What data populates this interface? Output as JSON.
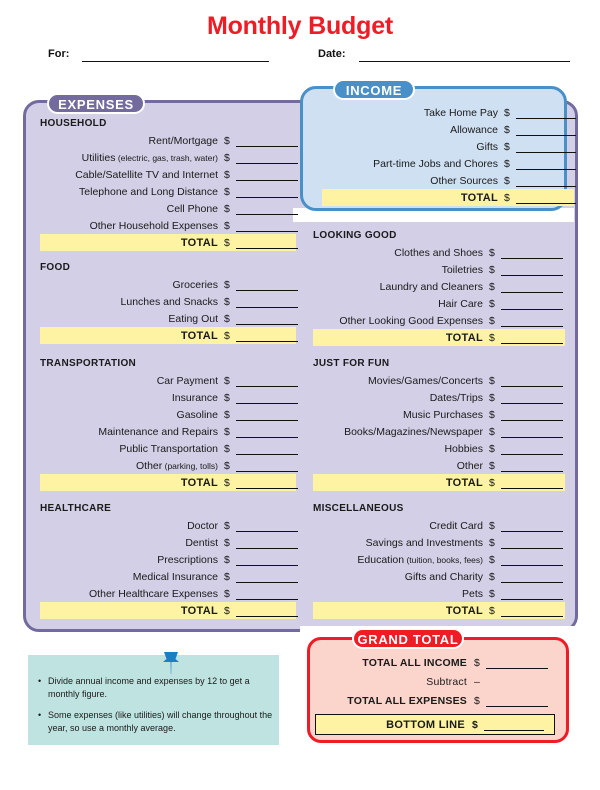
{
  "document": {
    "title": "Monthly Budget",
    "title_color": "#ee1c25"
  },
  "meta": {
    "for_label": "For:",
    "date_label": "Date:"
  },
  "currency_symbol": "$",
  "total_label": "TOTAL",
  "panels": {
    "expenses": {
      "tab_label": "EXPENSES",
      "fill": "#d3cfe6",
      "border": "#736a9e"
    },
    "income": {
      "tab_label": "INCOME",
      "fill": "#cfe0f2",
      "border": "#4a90c8"
    },
    "grand": {
      "tab_label": "GRAND TOTAL",
      "fill": "#fbd5cc",
      "border": "#ee1c25"
    }
  },
  "income": {
    "heading": "INCOME",
    "rows": [
      "Take Home Pay",
      "Allowance",
      "Gifts",
      "Part-time Jobs and Chores",
      "Other Sources"
    ],
    "total_label": "TOTAL"
  },
  "expenses": {
    "heading": "EXPENSES",
    "left_sections": [
      {
        "title": "HOUSEHOLD",
        "rows": [
          {
            "label": "Rent/Mortgage",
            "note": ""
          },
          {
            "label": "Utilities",
            "note": " (electric, gas, trash, water)"
          },
          {
            "label": "Cable/Satellite TV and Internet",
            "note": ""
          },
          {
            "label": "Telephone and Long Distance",
            "note": ""
          },
          {
            "label": "Cell Phone",
            "note": ""
          },
          {
            "label": "Other Household Expenses",
            "note": ""
          }
        ]
      },
      {
        "title": "FOOD",
        "rows": [
          {
            "label": "Groceries",
            "note": ""
          },
          {
            "label": "Lunches and Snacks",
            "note": ""
          },
          {
            "label": "Eating Out",
            "note": ""
          }
        ]
      },
      {
        "title": "TRANSPORTATION",
        "rows": [
          {
            "label": "Car Payment",
            "note": ""
          },
          {
            "label": "Insurance",
            "note": ""
          },
          {
            "label": "Gasoline",
            "note": ""
          },
          {
            "label": "Maintenance and Repairs",
            "note": ""
          },
          {
            "label": "Public Transportation",
            "note": ""
          },
          {
            "label": "Other",
            "note": " (parking, tolls)"
          }
        ]
      },
      {
        "title": "HEALTHCARE",
        "rows": [
          {
            "label": "Doctor",
            "note": ""
          },
          {
            "label": "Dentist",
            "note": ""
          },
          {
            "label": "Prescriptions",
            "note": ""
          },
          {
            "label": "Medical Insurance",
            "note": ""
          },
          {
            "label": "Other Healthcare Expenses",
            "note": ""
          }
        ]
      }
    ],
    "right_sections": [
      {
        "title": "LOOKING GOOD",
        "rows": [
          {
            "label": "Clothes and Shoes",
            "note": ""
          },
          {
            "label": "Toiletries",
            "note": ""
          },
          {
            "label": "Laundry and Cleaners",
            "note": ""
          },
          {
            "label": "Hair Care",
            "note": ""
          },
          {
            "label": "Other Looking Good Expenses",
            "note": ""
          }
        ]
      },
      {
        "title": "JUST FOR FUN",
        "rows": [
          {
            "label": "Movies/Games/Concerts",
            "note": ""
          },
          {
            "label": "Dates/Trips",
            "note": ""
          },
          {
            "label": "Music Purchases",
            "note": ""
          },
          {
            "label": "Books/Magazines/Newspaper",
            "note": ""
          },
          {
            "label": "Hobbies",
            "note": ""
          },
          {
            "label": "Other",
            "note": ""
          }
        ]
      },
      {
        "title": "MISCELLANEOUS",
        "rows": [
          {
            "label": "Credit Card",
            "note": ""
          },
          {
            "label": "Savings and Investments",
            "note": ""
          },
          {
            "label": "Education",
            "note": " (tuition, books, fees)"
          },
          {
            "label": "Gifts and Charity",
            "note": ""
          },
          {
            "label": "Pets",
            "note": ""
          }
        ]
      }
    ]
  },
  "grand_total": {
    "heading": "GRAND TOTAL",
    "rows": [
      {
        "label": "TOTAL ALL INCOME",
        "symbol": "$"
      },
      {
        "label": "Subtract",
        "symbol": "–"
      },
      {
        "label": "TOTAL ALL EXPENSES",
        "symbol": "$"
      }
    ],
    "bottom_line_label": "BOTTOM LINE",
    "bottom_line_symbol": "$"
  },
  "tips": {
    "items": [
      "Divide annual income and expenses by 12 to get a monthly figure.",
      "Some expenses (like utilities) will change throughout the year, so use a monthly average."
    ],
    "bullet": "•",
    "icon": "pushpin-icon",
    "fill": "#bfe3e0"
  }
}
